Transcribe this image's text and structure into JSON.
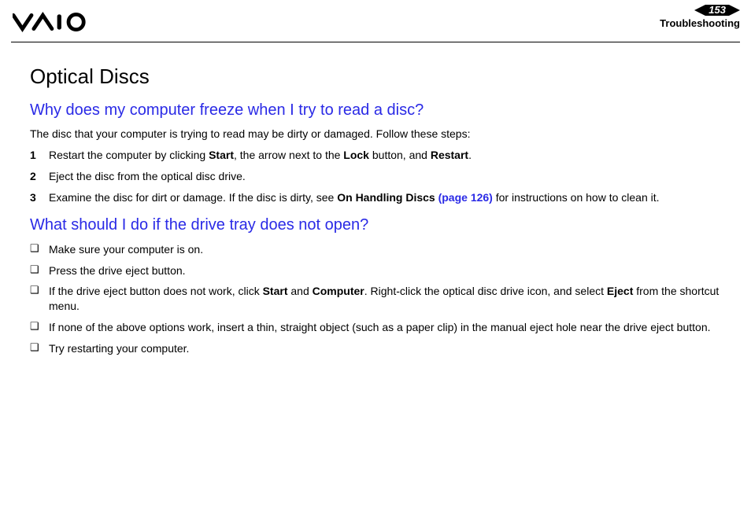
{
  "header": {
    "page_number": "153",
    "section": "Troubleshooting"
  },
  "title": "Optical Discs",
  "q1": {
    "question": "Why does my computer freeze when I try to read a disc?",
    "intro": "The disc that your computer is trying to read may be dirty or damaged. Follow these steps:",
    "steps": [
      {
        "num": "1",
        "pre": "Restart the computer by clicking ",
        "b1": "Start",
        "mid1": ", the arrow next to the ",
        "b2": "Lock",
        "mid2": " button, and ",
        "b3": "Restart",
        "post": "."
      },
      {
        "num": "2",
        "text": "Eject the disc from the optical disc drive."
      },
      {
        "num": "3",
        "pre": "Examine the disc for dirt or damage. If the disc is dirty, see ",
        "b1": "On Handling Discs",
        "link": " (page 126)",
        "post": " for instructions on how to clean it."
      }
    ]
  },
  "q2": {
    "question": "What should I do if the drive tray does not open?",
    "items": [
      {
        "text": "Make sure your computer is on."
      },
      {
        "text": "Press the drive eject button."
      },
      {
        "pre": "If the drive eject button does not work, click ",
        "b1": "Start",
        "mid1": " and ",
        "b2": "Computer",
        "mid2": ". Right-click the optical disc drive icon, and select ",
        "b3": "Eject",
        "post": " from the shortcut menu."
      },
      {
        "text": "If none of the above options work, insert a thin, straight object (such as a paper clip) in the manual eject hole near the drive eject button."
      },
      {
        "text": "Try restarting your computer."
      }
    ]
  }
}
